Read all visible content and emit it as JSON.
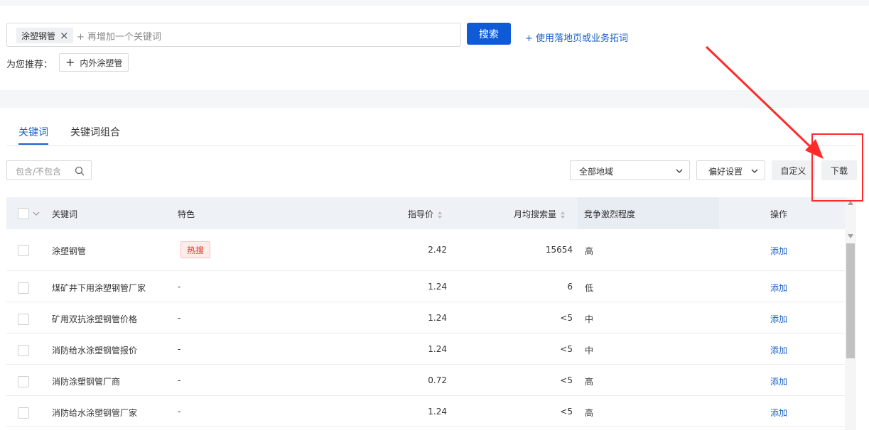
{
  "search": {
    "tag_label": "涂塑钢管",
    "placeholder": "+ 再增加一个关键词",
    "search_button": "搜索",
    "landing_link": "+ 使用落地页或业务拓词"
  },
  "recommend": {
    "label": "为您推荐：",
    "chip_label": "内外涂塑管"
  },
  "tabs": [
    {
      "label": "关键词",
      "active": true
    },
    {
      "label": "关键词组合",
      "active": false
    }
  ],
  "toolbar": {
    "filter_placeholder": "包含/不包含",
    "region_select": "全部地域",
    "preference_select": "偏好设置",
    "customize_button": "自定义",
    "download_button": "下载"
  },
  "table": {
    "headers": {
      "keyword": "关键词",
      "feature": "特色",
      "price": "指导价",
      "monthly_search": "月均搜索量",
      "competition": "竞争激烈程度",
      "action": "操作"
    },
    "rows": [
      {
        "keyword": "涂塑钢管",
        "feature": "热搜",
        "price": "2.42",
        "search": "15654",
        "competition": "高",
        "action": "添加"
      },
      {
        "keyword": "煤矿井下用涂塑钢管厂家",
        "feature": "-",
        "price": "1.24",
        "search": "6",
        "competition": "低",
        "action": "添加"
      },
      {
        "keyword": "矿用双抗涂塑钢管价格",
        "feature": "-",
        "price": "1.24",
        "search": "<5",
        "competition": "中",
        "action": "添加"
      },
      {
        "keyword": "消防给水涂塑钢管报价",
        "feature": "-",
        "price": "1.24",
        "search": "<5",
        "competition": "中",
        "action": "添加"
      },
      {
        "keyword": "消防涂塑钢管厂商",
        "feature": "-",
        "price": "0.72",
        "search": "<5",
        "competition": "高",
        "action": "添加"
      },
      {
        "keyword": "消防给水涂塑钢管厂家",
        "feature": "-",
        "price": "1.24",
        "search": "<5",
        "competition": "高",
        "action": "添加"
      }
    ]
  },
  "colors": {
    "accent": "#0f5bd7",
    "link": "#1a5fc9",
    "annotation": "#ff2a2a",
    "hot_badge": "#d9392b"
  }
}
